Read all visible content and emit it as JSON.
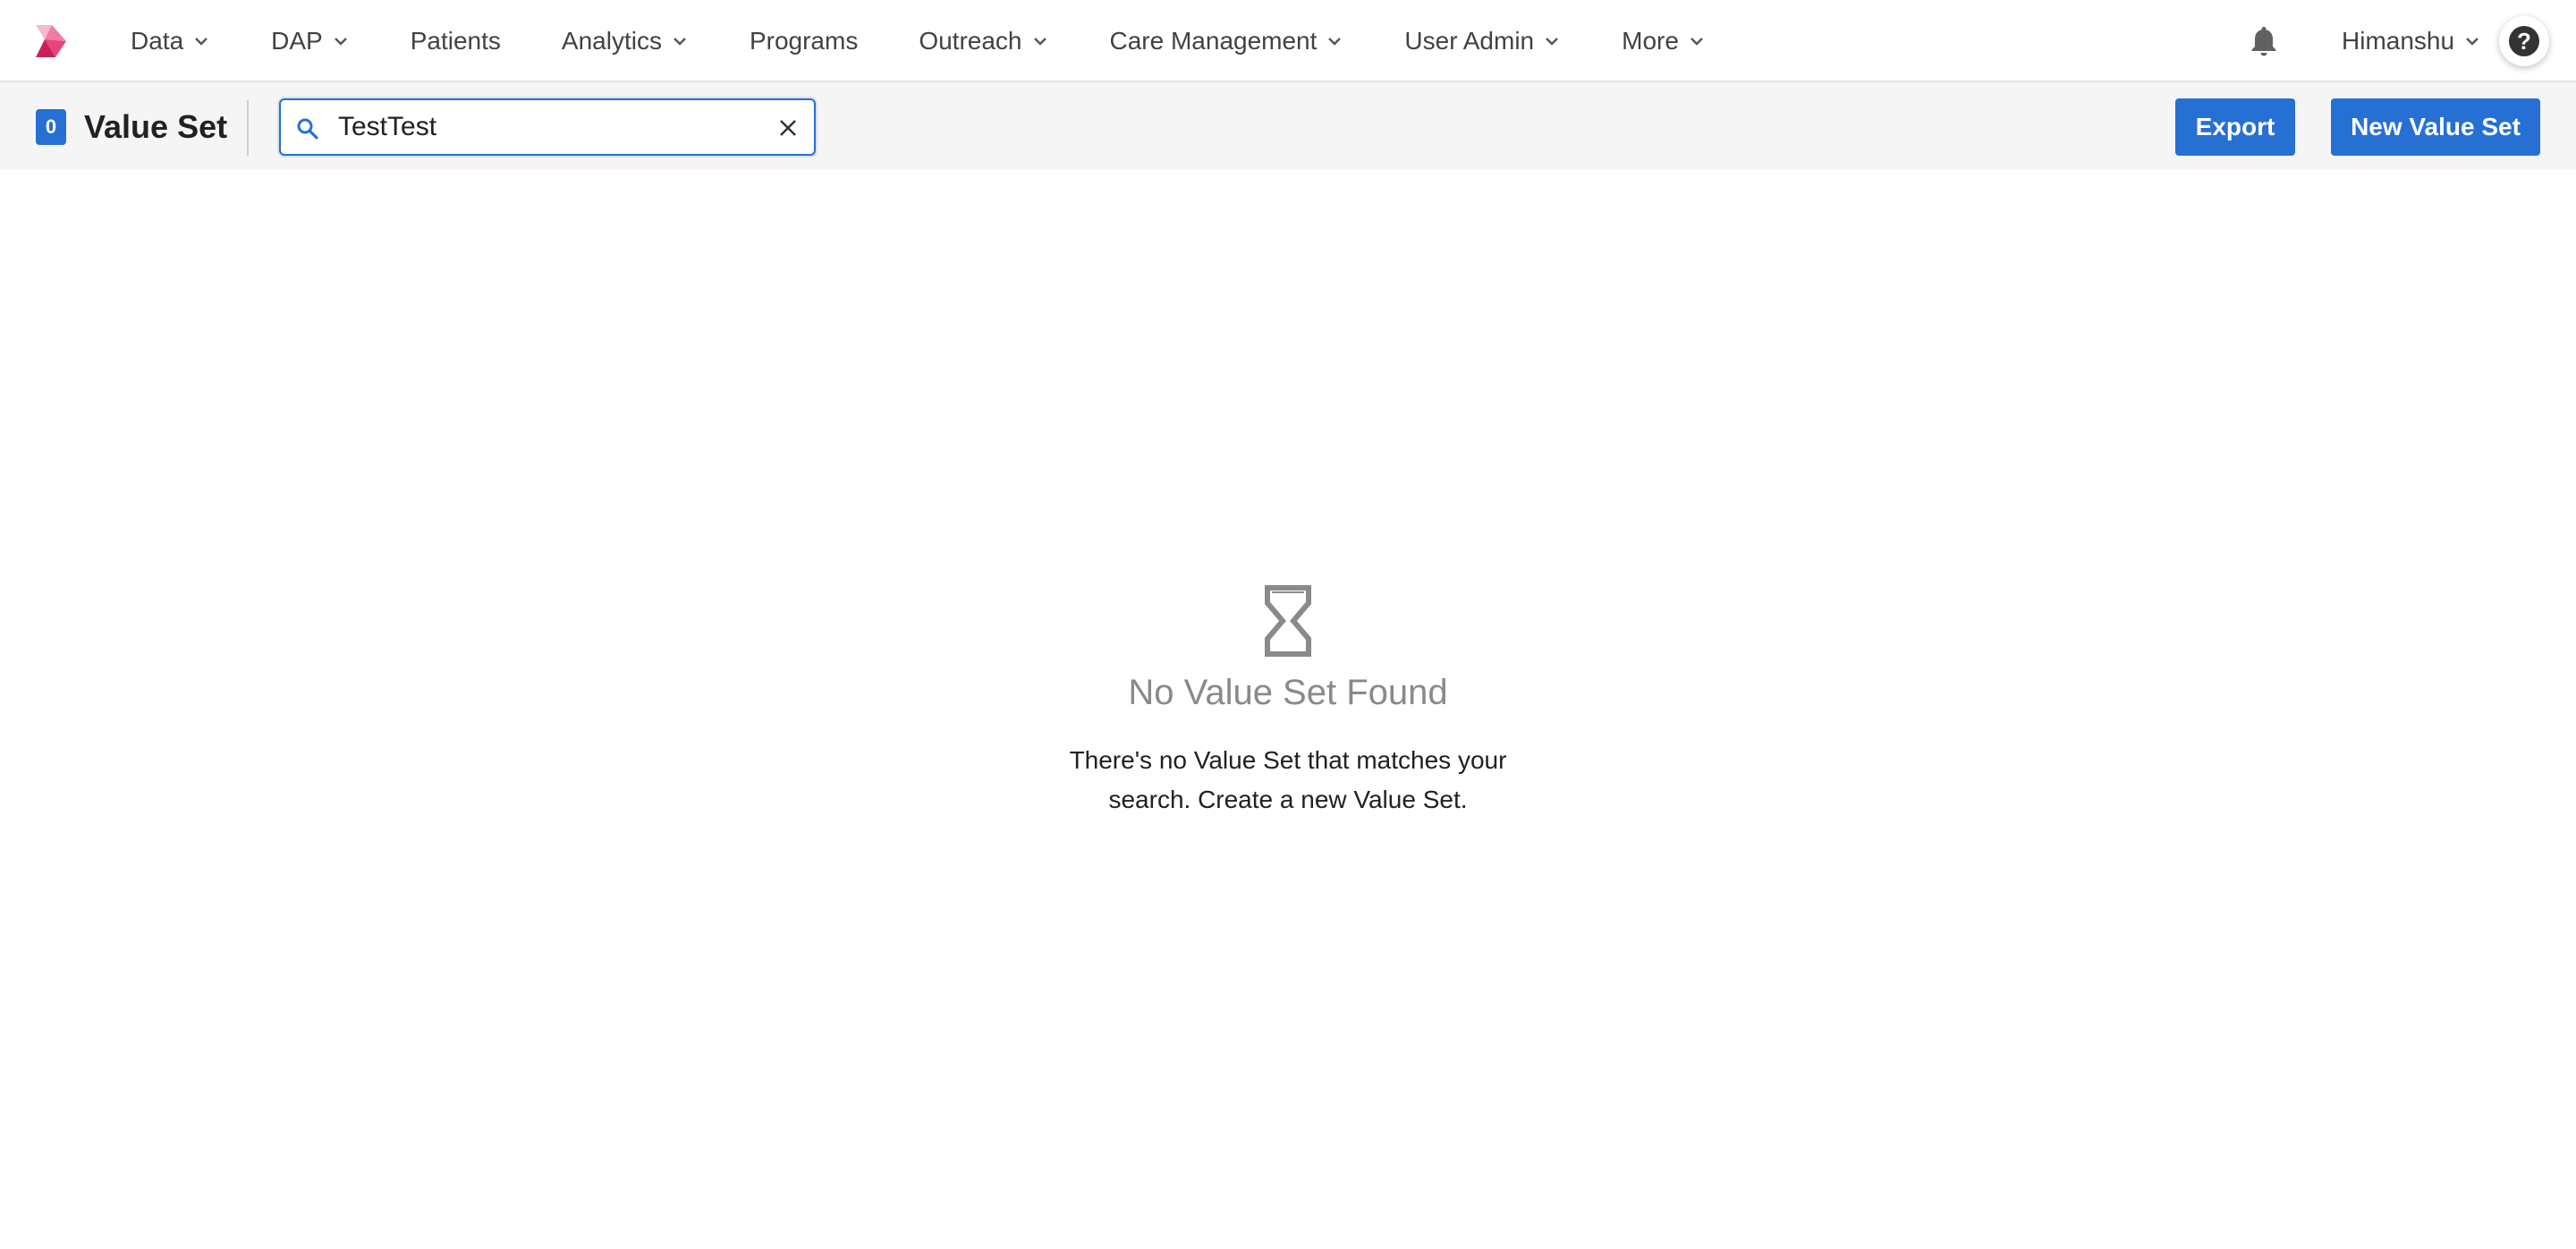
{
  "nav": {
    "items": [
      {
        "label": "Data",
        "has_dropdown": true
      },
      {
        "label": "DAP",
        "has_dropdown": true
      },
      {
        "label": "Patients",
        "has_dropdown": false
      },
      {
        "label": "Analytics",
        "has_dropdown": true
      },
      {
        "label": "Programs",
        "has_dropdown": false
      },
      {
        "label": "Outreach",
        "has_dropdown": true
      },
      {
        "label": "Care Management",
        "has_dropdown": true
      },
      {
        "label": "User Admin",
        "has_dropdown": true
      },
      {
        "label": "More",
        "has_dropdown": true
      }
    ],
    "user_name": "Himanshu",
    "help_glyph": "?"
  },
  "subheader": {
    "count": "0",
    "title": "Value Set",
    "search_value": "TestTest",
    "export_label": "Export",
    "new_label": "New Value Set"
  },
  "empty_state": {
    "icon": "hourglass-icon",
    "title": "No Value Set Found",
    "line1": "There's no Value Set that matches your",
    "line2": "search. Create a new Value Set."
  },
  "colors": {
    "accent": "#2670d4",
    "logo_pink": "#e8457a",
    "muted_text": "#8a8a8a",
    "subheader_bg": "#f5f5f5"
  }
}
